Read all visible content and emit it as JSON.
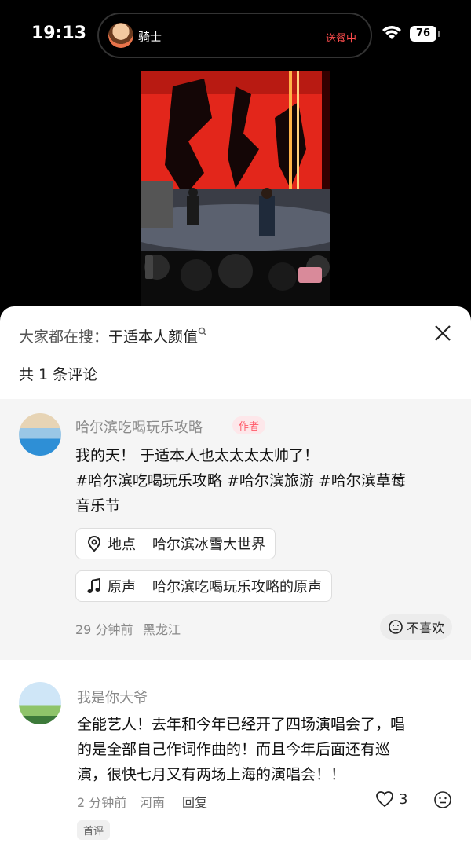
{
  "status_bar": {
    "time": "19:13",
    "island_name": "骑士",
    "island_status": "送餐中",
    "battery": "76"
  },
  "sheet": {
    "search_prefix": "大家都在搜：",
    "search_keyword": "于适本人颜值",
    "comment_count": "共 1 条评论"
  },
  "comments": [
    {
      "username": "哈尔滨吃喝玩乐攻略",
      "tag": "作者",
      "text_line1": "我的天！ 于适本人也太太太太帅了！",
      "text_line2": "#哈尔滨吃喝玩乐攻略 #哈尔滨旅游 #哈尔滨草莓",
      "text_line3": "音乐节",
      "location_label": "地点",
      "location_value": "哈尔滨冰雪大世界",
      "sound_label": "原声",
      "sound_value": "哈尔滨吃喝玩乐攻略的原声",
      "time": "29 分钟前",
      "region": "黑龙江",
      "dislike_label": "不喜欢"
    },
    {
      "username": "我是你大爷",
      "text_line1": "全能艺人！去年和今年已经开了四场演唱会了，唱",
      "text_line2": "的是全部自己作词作曲的！而且今年后面还有巡",
      "text_line3": "演，很快七月又有两场上海的演唱会！！",
      "time": "2 分钟前",
      "region": "河南",
      "reply_label": "回复",
      "likes": "3",
      "badge": "首评"
    }
  ],
  "colors": {
    "author_tag": "#ff5a6a",
    "stage_red": "#e3261b",
    "sheet_bg": "#ffffff",
    "author_comment_bg": "#f5f5f5"
  }
}
